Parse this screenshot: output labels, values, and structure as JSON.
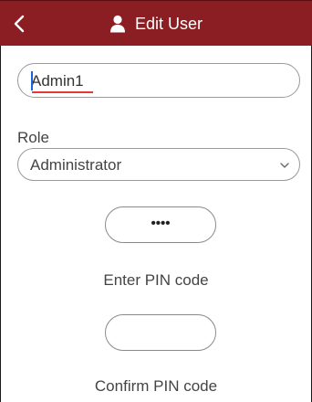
{
  "header": {
    "title": "Edit User",
    "back_icon": "chevron-left-icon",
    "user_icon": "user-icon",
    "background": "#8b1e22"
  },
  "form": {
    "name_value": "Admin1",
    "role_label": "Role",
    "role_value": "Administrator",
    "pin_value": "••••",
    "pin_label": "Enter PIN code",
    "confirm_value": "",
    "confirm_label": "Confirm PIN code"
  }
}
